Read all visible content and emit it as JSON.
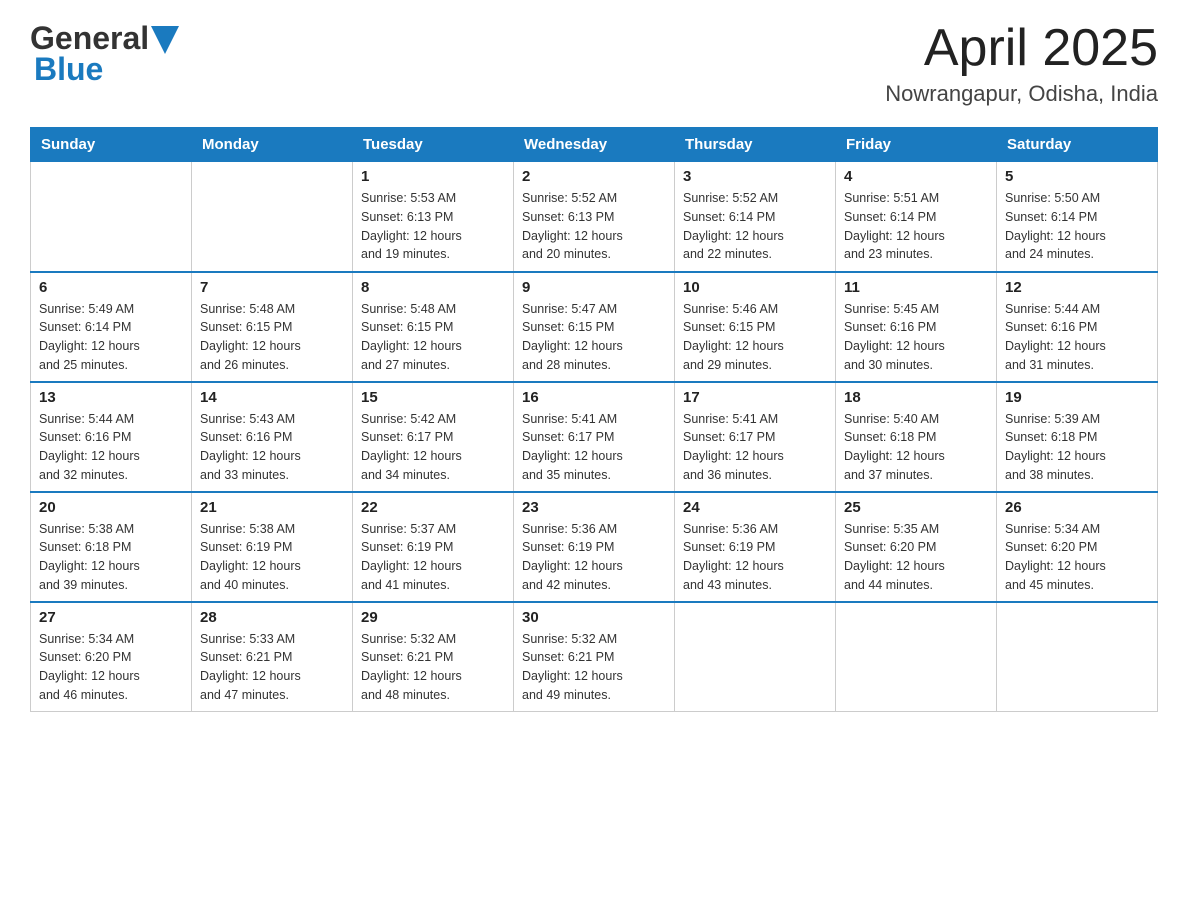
{
  "header": {
    "logo_general": "General",
    "logo_blue": "Blue",
    "month_year": "April 2025",
    "location": "Nowrangapur, Odisha, India"
  },
  "days_of_week": [
    "Sunday",
    "Monday",
    "Tuesday",
    "Wednesday",
    "Thursday",
    "Friday",
    "Saturday"
  ],
  "weeks": [
    [
      {
        "day": "",
        "info": ""
      },
      {
        "day": "",
        "info": ""
      },
      {
        "day": "1",
        "info": "Sunrise: 5:53 AM\nSunset: 6:13 PM\nDaylight: 12 hours\nand 19 minutes."
      },
      {
        "day": "2",
        "info": "Sunrise: 5:52 AM\nSunset: 6:13 PM\nDaylight: 12 hours\nand 20 minutes."
      },
      {
        "day": "3",
        "info": "Sunrise: 5:52 AM\nSunset: 6:14 PM\nDaylight: 12 hours\nand 22 minutes."
      },
      {
        "day": "4",
        "info": "Sunrise: 5:51 AM\nSunset: 6:14 PM\nDaylight: 12 hours\nand 23 minutes."
      },
      {
        "day": "5",
        "info": "Sunrise: 5:50 AM\nSunset: 6:14 PM\nDaylight: 12 hours\nand 24 minutes."
      }
    ],
    [
      {
        "day": "6",
        "info": "Sunrise: 5:49 AM\nSunset: 6:14 PM\nDaylight: 12 hours\nand 25 minutes."
      },
      {
        "day": "7",
        "info": "Sunrise: 5:48 AM\nSunset: 6:15 PM\nDaylight: 12 hours\nand 26 minutes."
      },
      {
        "day": "8",
        "info": "Sunrise: 5:48 AM\nSunset: 6:15 PM\nDaylight: 12 hours\nand 27 minutes."
      },
      {
        "day": "9",
        "info": "Sunrise: 5:47 AM\nSunset: 6:15 PM\nDaylight: 12 hours\nand 28 minutes."
      },
      {
        "day": "10",
        "info": "Sunrise: 5:46 AM\nSunset: 6:15 PM\nDaylight: 12 hours\nand 29 minutes."
      },
      {
        "day": "11",
        "info": "Sunrise: 5:45 AM\nSunset: 6:16 PM\nDaylight: 12 hours\nand 30 minutes."
      },
      {
        "day": "12",
        "info": "Sunrise: 5:44 AM\nSunset: 6:16 PM\nDaylight: 12 hours\nand 31 minutes."
      }
    ],
    [
      {
        "day": "13",
        "info": "Sunrise: 5:44 AM\nSunset: 6:16 PM\nDaylight: 12 hours\nand 32 minutes."
      },
      {
        "day": "14",
        "info": "Sunrise: 5:43 AM\nSunset: 6:16 PM\nDaylight: 12 hours\nand 33 minutes."
      },
      {
        "day": "15",
        "info": "Sunrise: 5:42 AM\nSunset: 6:17 PM\nDaylight: 12 hours\nand 34 minutes."
      },
      {
        "day": "16",
        "info": "Sunrise: 5:41 AM\nSunset: 6:17 PM\nDaylight: 12 hours\nand 35 minutes."
      },
      {
        "day": "17",
        "info": "Sunrise: 5:41 AM\nSunset: 6:17 PM\nDaylight: 12 hours\nand 36 minutes."
      },
      {
        "day": "18",
        "info": "Sunrise: 5:40 AM\nSunset: 6:18 PM\nDaylight: 12 hours\nand 37 minutes."
      },
      {
        "day": "19",
        "info": "Sunrise: 5:39 AM\nSunset: 6:18 PM\nDaylight: 12 hours\nand 38 minutes."
      }
    ],
    [
      {
        "day": "20",
        "info": "Sunrise: 5:38 AM\nSunset: 6:18 PM\nDaylight: 12 hours\nand 39 minutes."
      },
      {
        "day": "21",
        "info": "Sunrise: 5:38 AM\nSunset: 6:19 PM\nDaylight: 12 hours\nand 40 minutes."
      },
      {
        "day": "22",
        "info": "Sunrise: 5:37 AM\nSunset: 6:19 PM\nDaylight: 12 hours\nand 41 minutes."
      },
      {
        "day": "23",
        "info": "Sunrise: 5:36 AM\nSunset: 6:19 PM\nDaylight: 12 hours\nand 42 minutes."
      },
      {
        "day": "24",
        "info": "Sunrise: 5:36 AM\nSunset: 6:19 PM\nDaylight: 12 hours\nand 43 minutes."
      },
      {
        "day": "25",
        "info": "Sunrise: 5:35 AM\nSunset: 6:20 PM\nDaylight: 12 hours\nand 44 minutes."
      },
      {
        "day": "26",
        "info": "Sunrise: 5:34 AM\nSunset: 6:20 PM\nDaylight: 12 hours\nand 45 minutes."
      }
    ],
    [
      {
        "day": "27",
        "info": "Sunrise: 5:34 AM\nSunset: 6:20 PM\nDaylight: 12 hours\nand 46 minutes."
      },
      {
        "day": "28",
        "info": "Sunrise: 5:33 AM\nSunset: 6:21 PM\nDaylight: 12 hours\nand 47 minutes."
      },
      {
        "day": "29",
        "info": "Sunrise: 5:32 AM\nSunset: 6:21 PM\nDaylight: 12 hours\nand 48 minutes."
      },
      {
        "day": "30",
        "info": "Sunrise: 5:32 AM\nSunset: 6:21 PM\nDaylight: 12 hours\nand 49 minutes."
      },
      {
        "day": "",
        "info": ""
      },
      {
        "day": "",
        "info": ""
      },
      {
        "day": "",
        "info": ""
      }
    ]
  ]
}
